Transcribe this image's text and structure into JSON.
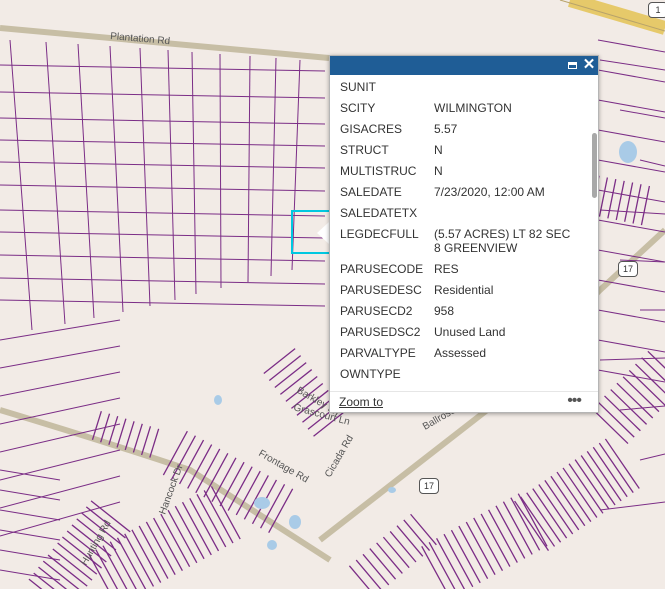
{
  "colors": {
    "land": "#f2ebe6",
    "parcel_line": "#7b2d86",
    "road": "#c7bea5",
    "highway": "#e6c96a",
    "water": "#a9cbe7",
    "selection": "#00c8e0",
    "header": "#1f5d96"
  },
  "map": {
    "road_labels": [
      "Plantation Rd",
      "Barkley Ln",
      "Grascourt Ln",
      "Frontage Rd",
      "Ballrose Rd",
      "Cicada Rd",
      "Hancock Dr",
      "Hunting Rd"
    ],
    "route_shield_1": "17",
    "route_shield_2": "17",
    "route_shield_3": "1"
  },
  "popup": {
    "maximize_icon": "maximize-icon",
    "close_icon": "close-icon",
    "rows": [
      {
        "name": "SUNIT",
        "value": ""
      },
      {
        "name": "SCITY",
        "value": "WILMINGTON"
      },
      {
        "name": "GISACRES",
        "value": "5.57"
      },
      {
        "name": "STRUCT",
        "value": "N"
      },
      {
        "name": "MULTISTRUC",
        "value": "N"
      },
      {
        "name": "SALEDATE",
        "value": "7/23/2020, 12:00 AM"
      },
      {
        "name": "SALEDATETX",
        "value": ""
      },
      {
        "name": "LEGDECFULL",
        "value": "(5.57 ACRES) LT 82 SEC 8 GREENVIEW"
      },
      {
        "name": "PARUSECODE",
        "value": "RES"
      },
      {
        "name": "PARUSEDESC",
        "value": "Residential"
      },
      {
        "name": "PARUSECD2",
        "value": "958"
      },
      {
        "name": "PARUSEDSC2",
        "value": "Unused Land"
      },
      {
        "name": "PARVALTYPE",
        "value": "Assessed"
      },
      {
        "name": "OWNTYPE",
        "value": ""
      }
    ],
    "zoom_label": "Zoom to",
    "more_label": "•••"
  }
}
